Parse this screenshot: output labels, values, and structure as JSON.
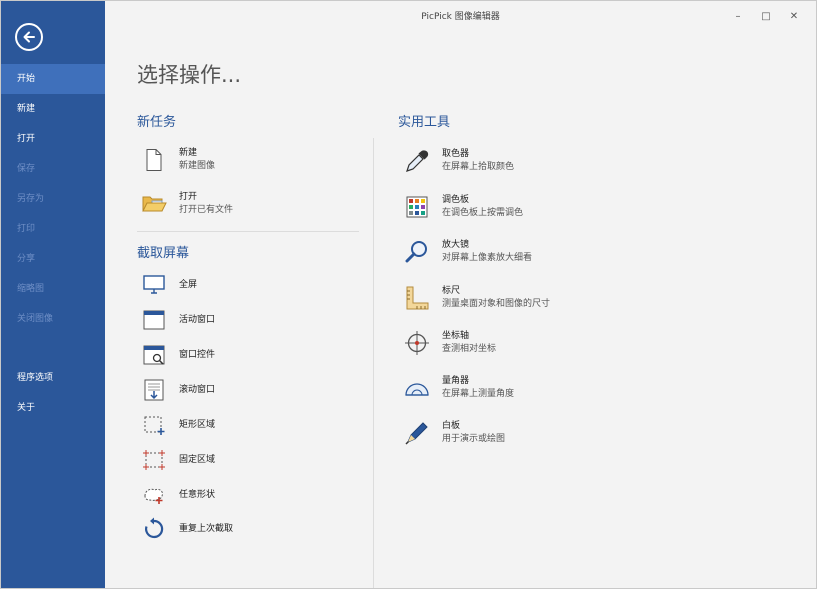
{
  "window": {
    "title": "PicPick 图像编辑器",
    "minimize": "–",
    "maximize": "□",
    "close": "✕"
  },
  "sidebar": {
    "items": [
      {
        "label": "开始"
      },
      {
        "label": "新建"
      },
      {
        "label": "打开"
      },
      {
        "label": "保存"
      },
      {
        "label": "另存为"
      },
      {
        "label": "打印"
      },
      {
        "label": "分享"
      },
      {
        "label": "缩略图"
      },
      {
        "label": "关闭图像"
      }
    ],
    "bottom": [
      {
        "label": "程序选项"
      },
      {
        "label": "关于"
      }
    ]
  },
  "main": {
    "heading": "选择操作...",
    "new_task": {
      "title": "新任务",
      "items": [
        {
          "label": "新建",
          "desc": "新建图像"
        },
        {
          "label": "打开",
          "desc": "打开已有文件"
        }
      ]
    },
    "capture": {
      "title": "截取屏幕",
      "items": [
        {
          "label": "全屏"
        },
        {
          "label": "活动窗口"
        },
        {
          "label": "窗口控件"
        },
        {
          "label": "滚动窗口"
        },
        {
          "label": "矩形区域"
        },
        {
          "label": "固定区域"
        },
        {
          "label": "任意形状"
        },
        {
          "label": "重复上次截取"
        }
      ]
    },
    "tools": {
      "title": "实用工具",
      "items": [
        {
          "label": "取色器",
          "desc": "在屏幕上拾取颜色"
        },
        {
          "label": "调色板",
          "desc": "在调色板上按需调色"
        },
        {
          "label": "放大镜",
          "desc": "对屏幕上像素放大细看"
        },
        {
          "label": "标尺",
          "desc": "测量桌面对象和图像的尺寸"
        },
        {
          "label": "坐标轴",
          "desc": "查测相对坐标"
        },
        {
          "label": "量角器",
          "desc": "在屏幕上测量角度"
        },
        {
          "label": "白板",
          "desc": "用于演示或绘图"
        }
      ]
    }
  },
  "colors": {
    "sidebar": "#2b579a",
    "sidebar_active": "#3f70bb",
    "accent": "#2b579a"
  }
}
